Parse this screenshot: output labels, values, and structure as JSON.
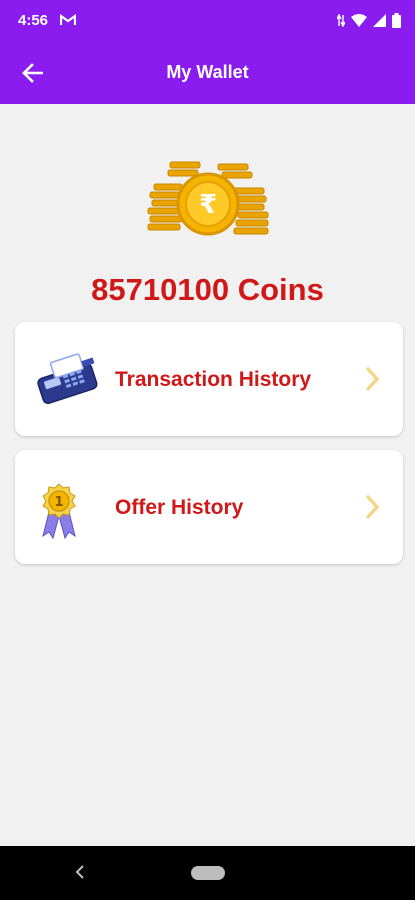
{
  "status_bar": {
    "time": "4:56",
    "icons": [
      "gmail-icon",
      "data-arrows-icon",
      "wifi-icon",
      "signal-icon",
      "battery-icon"
    ]
  },
  "app_bar": {
    "title": "My Wallet",
    "back_icon": "arrow-left-icon"
  },
  "wallet": {
    "balance_text": "85710100 Coins",
    "coin_icon": "rupee-coin-stack-icon"
  },
  "menu": [
    {
      "label": "Transaction History",
      "icon": "card-machine-icon"
    },
    {
      "label": "Offer History",
      "icon": "badge-medal-icon"
    }
  ],
  "colors": {
    "primary": "#8a1cf0",
    "accent_text": "#d01818",
    "background": "#f1f1f1",
    "chevron": "#f4d58a"
  },
  "nav_bar": {
    "icons": [
      "nav-back-icon",
      "nav-home-icon"
    ]
  }
}
